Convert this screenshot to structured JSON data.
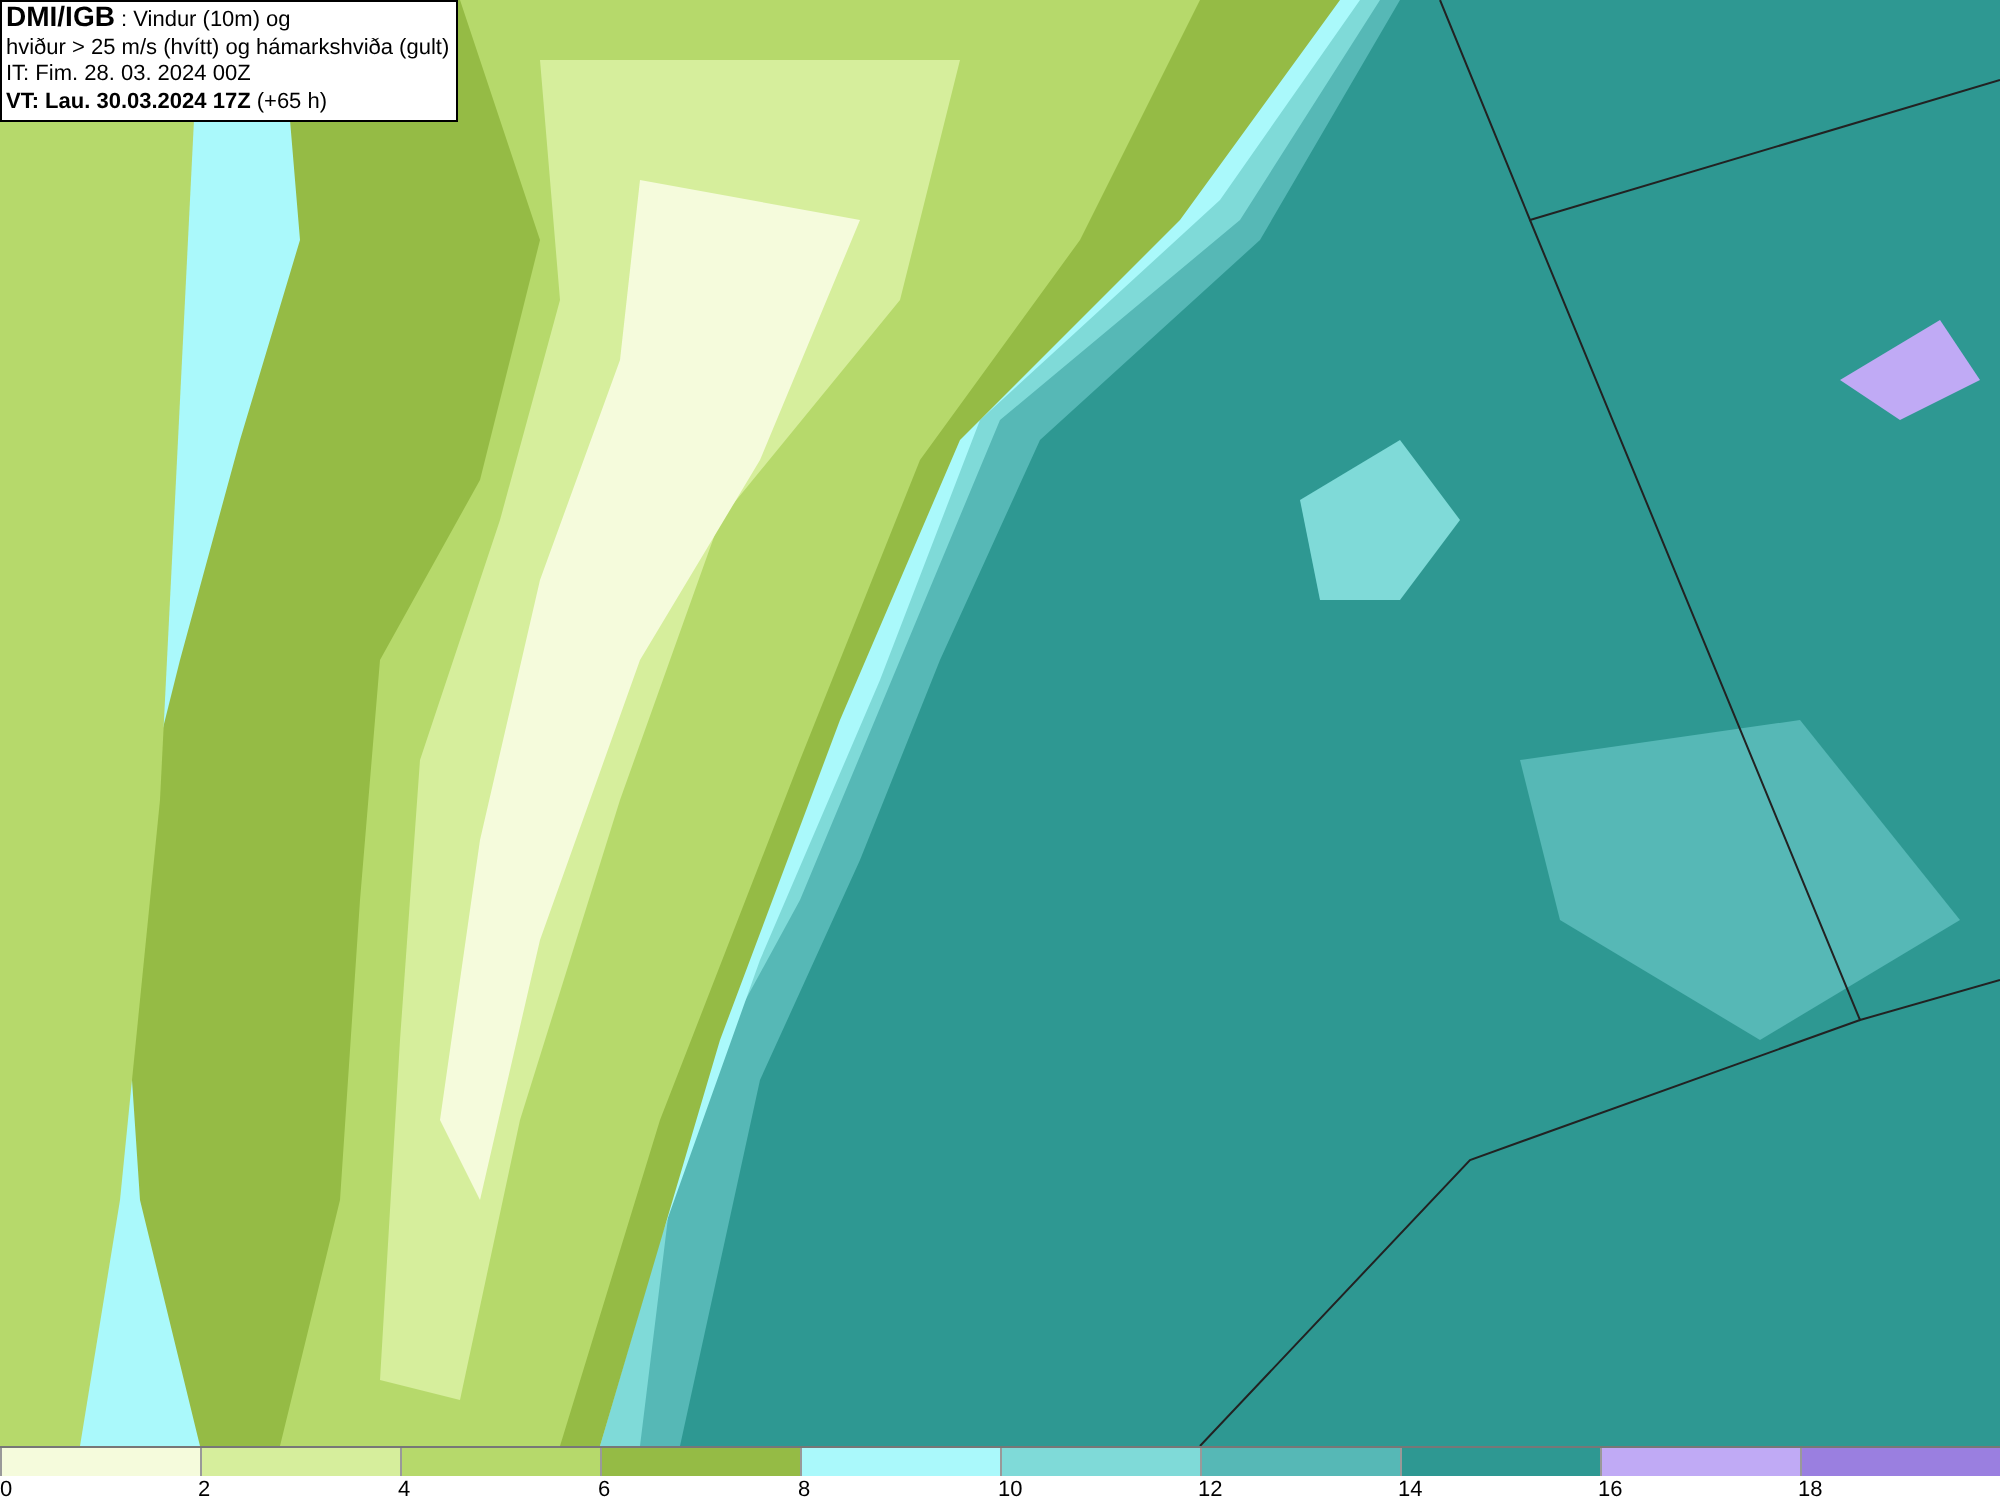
{
  "title_box": {
    "lines": [
      "**DMI/IGB** : Vindur (10m) og",
      "hviður > 25 m/s (hvítt) og hámarkshviða (gult)",
      "IT: Fim. 28. 03. 2024 00Z",
      "**VT: Lau. 30.03.2024 17Z** (+65 h)"
    ]
  },
  "legend": [
    {
      "label": "0",
      "color": "#f5fbdc"
    },
    {
      "label": "2",
      "color": "#d6ee9c"
    },
    {
      "label": "4",
      "color": "#b6d96b"
    },
    {
      "label": "6",
      "color": "#95bb45"
    },
    {
      "label": "8",
      "color": "#aaf9fb"
    },
    {
      "label": "10",
      "color": "#7fdad8"
    },
    {
      "label": "12",
      "color": "#56b8b6"
    },
    {
      "label": "14",
      "color": "#2e9892"
    },
    {
      "label": "16",
      "color": "#c0aaf5"
    },
    {
      "label": "18",
      "color": "#9a7fe0"
    }
  ]
}
